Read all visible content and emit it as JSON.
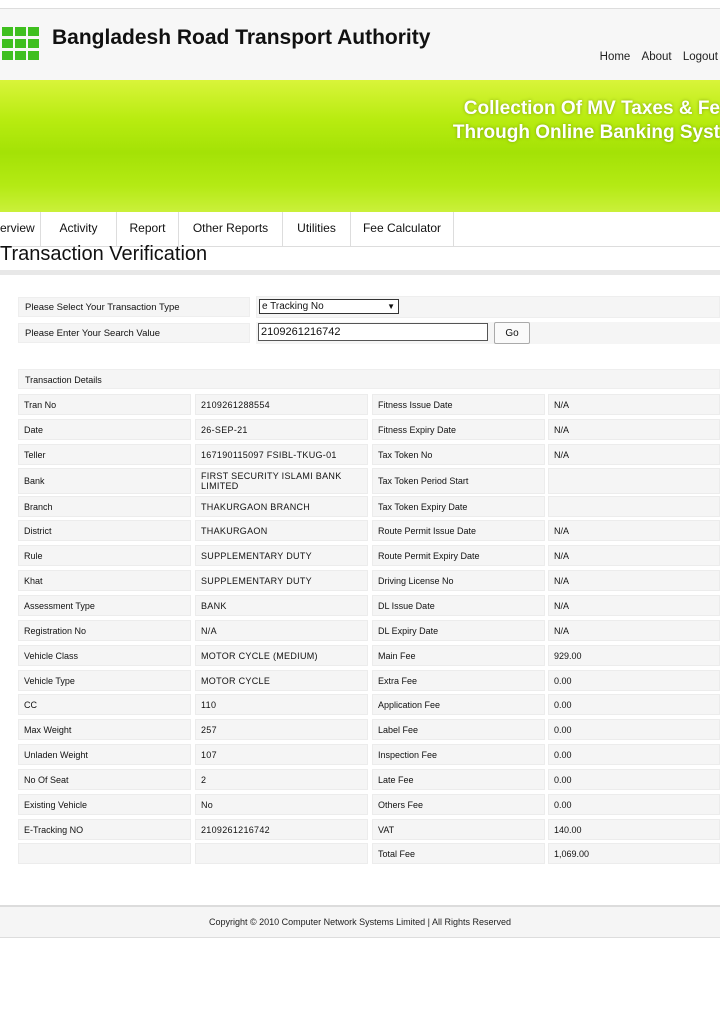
{
  "header": {
    "title": "Bangladesh Road Transport Authority",
    "nav": [
      "Home",
      "About",
      "Logout"
    ]
  },
  "banner": {
    "line1": "Collection Of MV Taxes & Fe",
    "line2": "Through Online Banking Syst"
  },
  "navbar": {
    "items": [
      "erview",
      "Activity",
      "Report",
      "Other Reports",
      "Utilities",
      "Fee Calculator"
    ]
  },
  "page": {
    "title": "Transaction Verification"
  },
  "search": {
    "type_label": "Please Select Your Transaction Type",
    "type_value": "e Tracking No",
    "value_label": "Please Enter Your Search Value",
    "value": "2109261216742",
    "go_label": "Go"
  },
  "details": {
    "header": "Transaction Details",
    "rows": [
      [
        "Tran No",
        "2109261288554",
        "Fitness Issue Date",
        "N/A"
      ],
      [
        "Date",
        "26-SEP-21",
        "Fitness Expiry Date",
        "N/A"
      ],
      [
        "Teller",
        "167190115097 FSIBL-TKUG-01",
        "Tax Token No",
        "N/A"
      ],
      [
        "Bank",
        "FIRST SECURITY ISLAMI BANK LIMITED",
        "Tax Token Period Start",
        ""
      ],
      [
        "Branch",
        "THAKURGAON BRANCH",
        "Tax Token Expiry Date",
        ""
      ],
      [
        "District",
        "THAKURGAON",
        "Route Permit Issue Date",
        "N/A"
      ],
      [
        "Rule",
        "SUPPLEMENTARY DUTY",
        "Route Permit Expiry Date",
        "N/A"
      ],
      [
        "Khat",
        "SUPPLEMENTARY DUTY",
        "Driving License No",
        "N/A"
      ],
      [
        "Assessment Type",
        "BANK",
        "DL Issue Date",
        "N/A"
      ],
      [
        "Registration No",
        "N/A",
        "DL Expiry Date",
        "N/A"
      ],
      [
        "Vehicle Class",
        "MOTOR CYCLE (MEDIUM)",
        "Main Fee",
        "929.00"
      ],
      [
        "Vehicle Type",
        "MOTOR CYCLE",
        "Extra Fee",
        "0.00"
      ],
      [
        "CC",
        "110",
        "Application Fee",
        "0.00"
      ],
      [
        "Max Weight",
        "257",
        "Label Fee",
        "0.00"
      ],
      [
        "Unladen Weight",
        "107",
        "Inspection Fee",
        "0.00"
      ],
      [
        "No Of Seat",
        "2",
        "Late Fee",
        "0.00"
      ],
      [
        "Existing Vehicle",
        "No",
        "Others Fee",
        "0.00"
      ],
      [
        "E-Tracking NO",
        "2109261216742",
        "VAT",
        "140.00"
      ],
      [
        "",
        "",
        "Total Fee",
        "1,069.00"
      ]
    ]
  },
  "footer": {
    "text": "Copyright © 2010 Computer Network Systems Limited | All Rights Reserved"
  },
  "colors": {
    "banner": "#a4e206",
    "logo": "#3fbf1f"
  }
}
